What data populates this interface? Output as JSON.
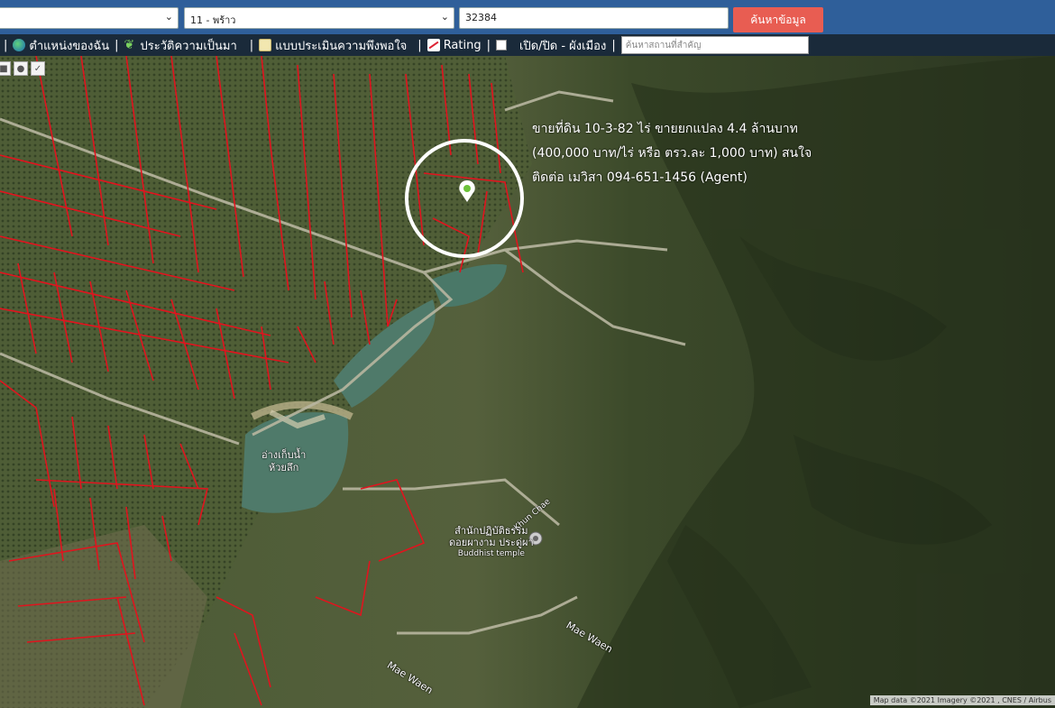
{
  "toolbar": {
    "district_select": "11 - พร้าว",
    "parcel_input": "32384",
    "search_button": "ค้นหาข้อมูล"
  },
  "menu": {
    "my_location": "ตำแหน่งของฉัน",
    "history": "ประวัติความเป็นมา",
    "survey": "แบบประเมินความพึงพอใจ",
    "rating": "Rating",
    "toggle_zoning": "เปิด/ปิด - ผังเมือง",
    "search_placeholder": "ค้นหาสถานที่สำคัญ"
  },
  "map": {
    "annotation": [
      "ขายที่ดิน 10-3-82 ไร่ ขายยกแปลง 4.4 ล้านบาท",
      "(400,000 บาท/ไร่ หรือ ตรว.ละ 1,000 บาท) สนใจ",
      "ติดต่อ เมวิสา 094-651-1456 (Agent)"
    ],
    "reservoir_label_1": "อ่างเก็บน้ำ",
    "reservoir_label_2": "ห้วยลึก",
    "temple_name_1": "สำนักปฏิบัติธรรม",
    "temple_name_2": "ดอยผางาม ประดู่ผา",
    "temple_type": "Buddhist temple",
    "road_khun_chae": "Khun Chae",
    "river_1": "Mae Waen",
    "river_2": "Mae Waen",
    "attribution": "Map data ©2021 Imagery ©2021 , CNES / Airbus"
  },
  "colors": {
    "header_bg": "#2f5f9a",
    "menu_bg": "#1a2a3a",
    "search_button": "#e85d52",
    "parcel_lines": "#e0141e"
  }
}
